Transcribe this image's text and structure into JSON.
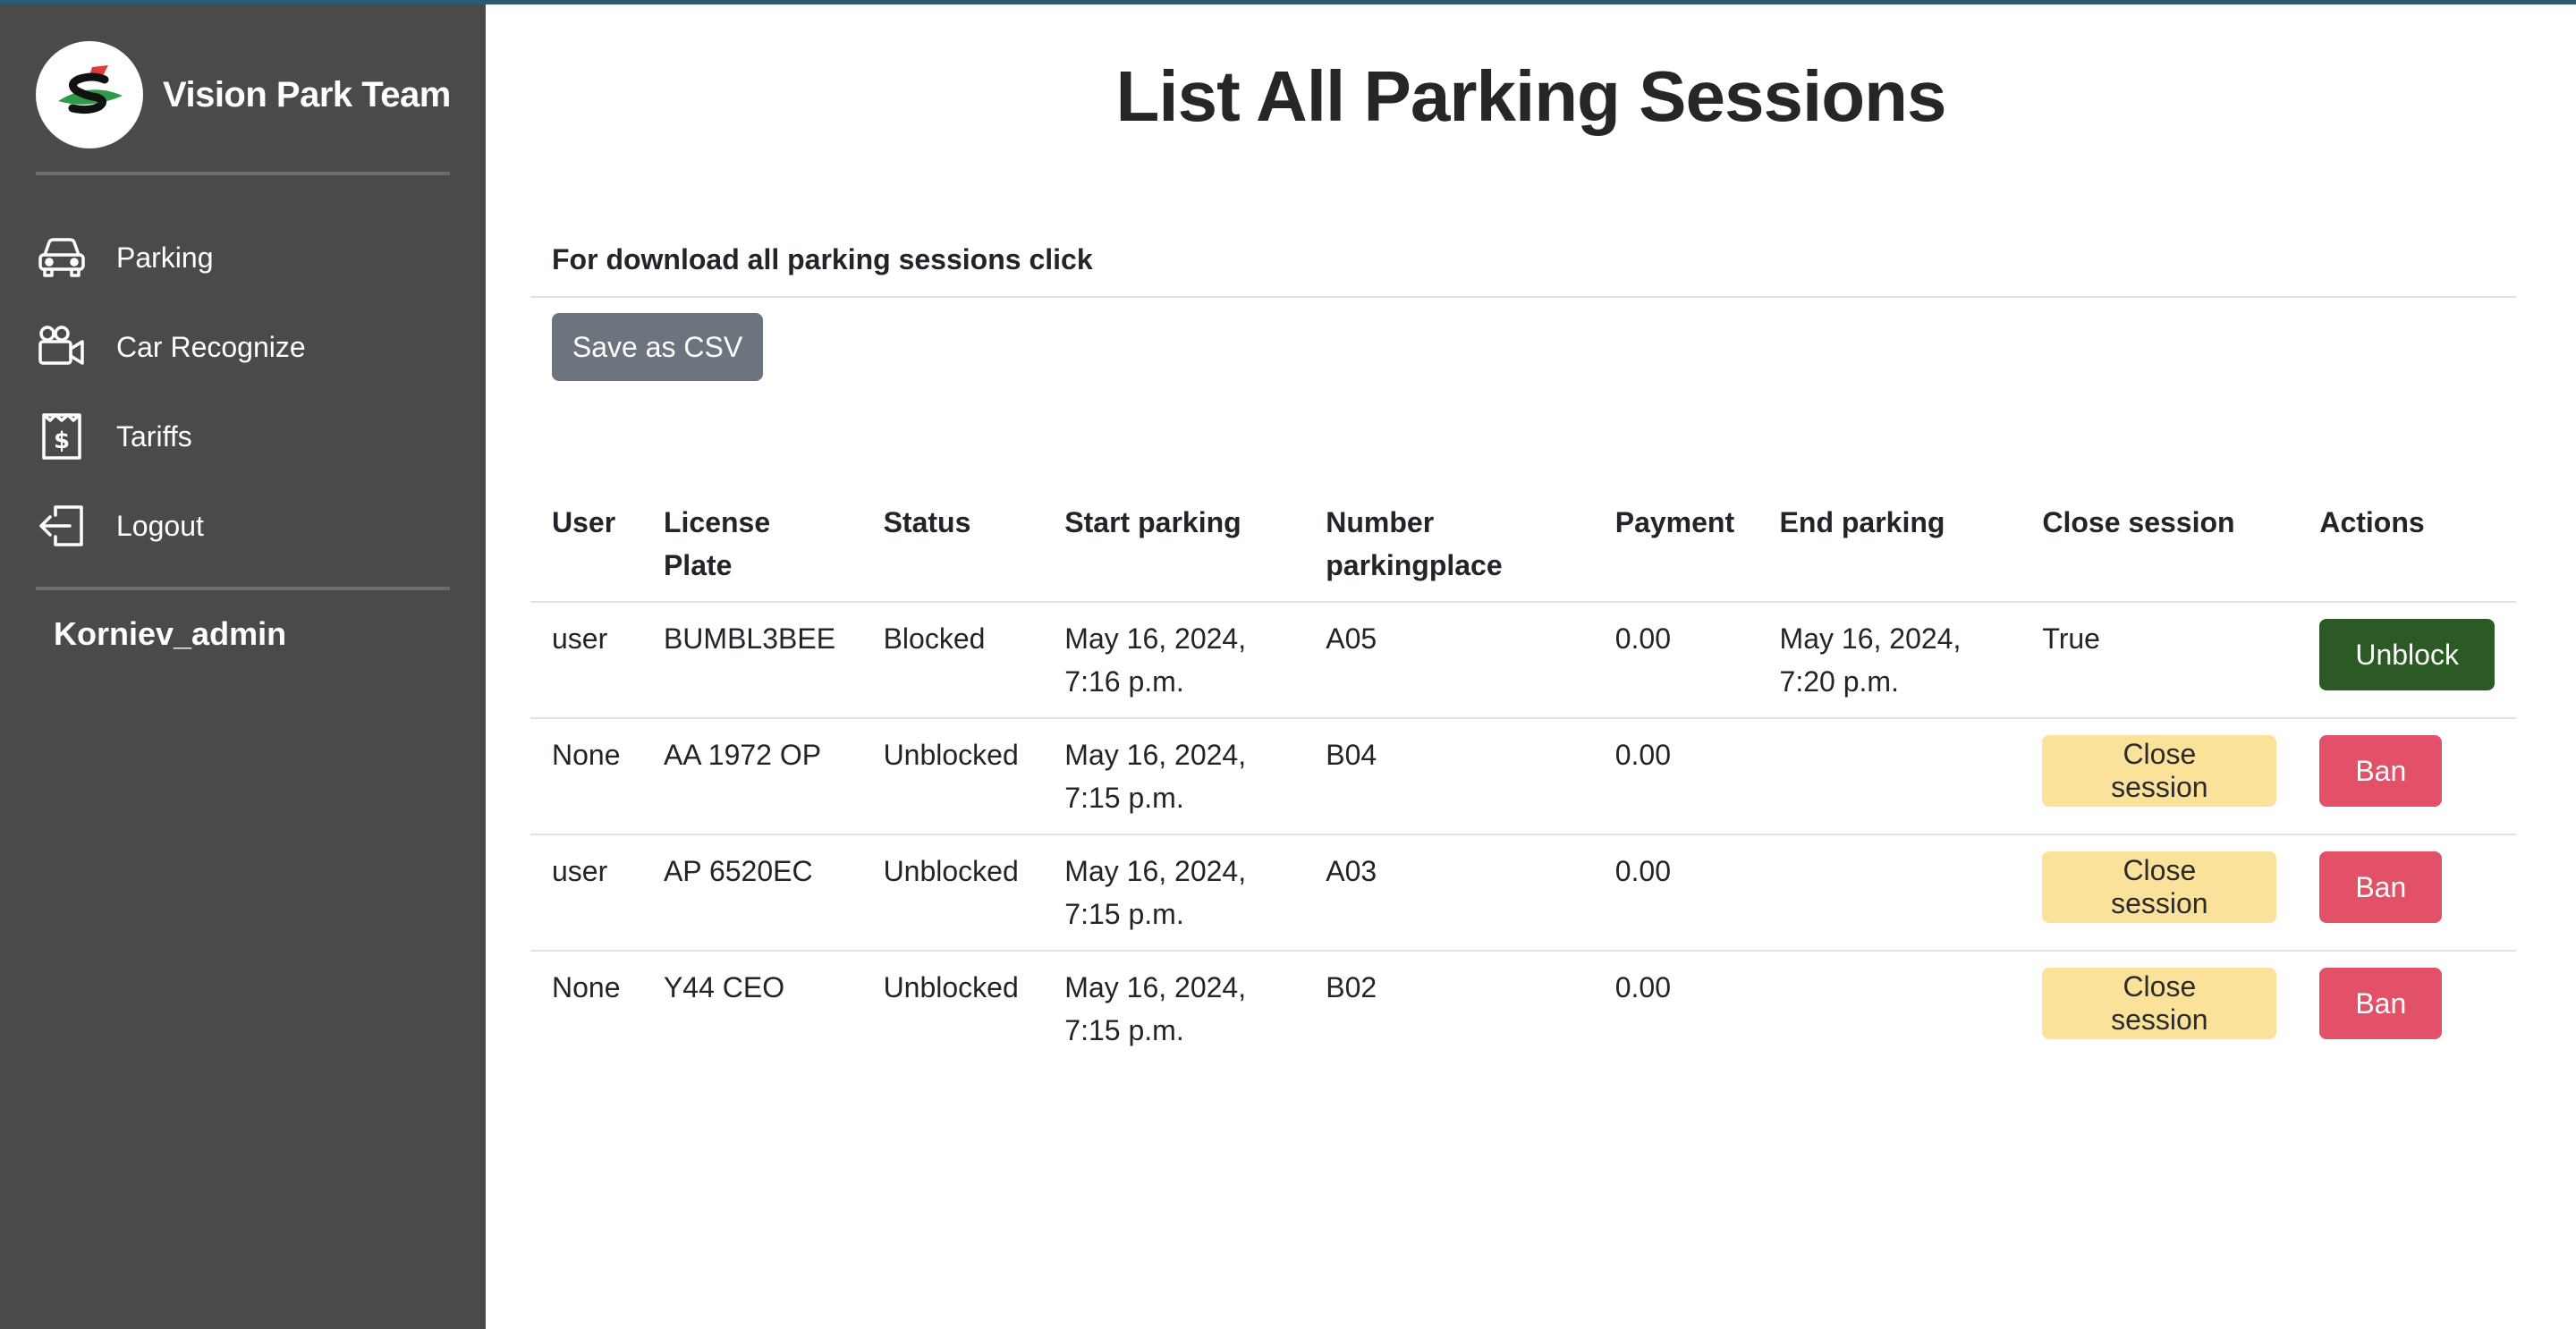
{
  "sidebar": {
    "brand": "Vision Park Team",
    "items": [
      {
        "label": "Parking",
        "icon": "car-icon"
      },
      {
        "label": "Car Recognize",
        "icon": "camera-icon"
      },
      {
        "label": "Tariffs",
        "icon": "receipt-dollar-icon"
      },
      {
        "label": "Logout",
        "icon": "logout-icon"
      }
    ],
    "username": "Korniev_admin"
  },
  "main": {
    "title": "List All Parking Sessions",
    "download_text": "For download all parking sessions click",
    "csv_button": "Save as CSV"
  },
  "table": {
    "headers": [
      "User",
      "License Plate",
      "Status",
      "Start parking",
      "Number parkingplace",
      "Payment",
      "End parking",
      "Close session",
      "Actions"
    ],
    "rows": [
      {
        "user": "user",
        "plate": "BUMBL3BEE",
        "status": "Blocked",
        "start": "May 16, 2024, 7:16 p.m.",
        "place": "A05",
        "payment": "0.00",
        "end": "May 16, 2024, 7:20 p.m.",
        "close": "True",
        "action": "Unblock"
      },
      {
        "user": "None",
        "plate": "AA 1972 OP",
        "status": "Unblocked",
        "start": "May 16, 2024, 7:15 p.m.",
        "place": "B04",
        "payment": "0.00",
        "end": "",
        "close": "Close session",
        "action": "Ban"
      },
      {
        "user": "user",
        "plate": "AP 6520EC",
        "status": "Unblocked",
        "start": "May 16, 2024, 7:15 p.m.",
        "place": "A03",
        "payment": "0.00",
        "end": "",
        "close": "Close session",
        "action": "Ban"
      },
      {
        "user": "None",
        "plate": "Y44 CEO",
        "status": "Unblocked",
        "start": "May 16, 2024, 7:15 p.m.",
        "place": "B02",
        "payment": "0.00",
        "end": "",
        "close": "Close session",
        "action": "Ban"
      }
    ]
  },
  "colors": {
    "sidebar_bg": "#4b4a48",
    "csv_button": "#6c757d",
    "close_session_button": "#fbe29b",
    "ban_button": "#e25168",
    "unblock_button": "#2c5a24"
  }
}
